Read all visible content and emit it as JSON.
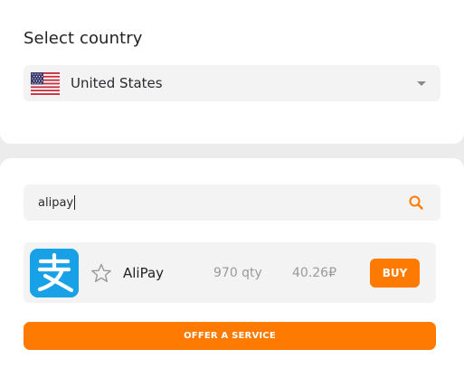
{
  "country_section": {
    "title": "Select country",
    "selected_country": "United States",
    "flag_icon": "us-flag-icon"
  },
  "search": {
    "value": "alipay",
    "icon": "search-icon"
  },
  "results": [
    {
      "name": "AliPay",
      "quantity": "970 qty",
      "price": "40.26₽",
      "buy_label": "BUY",
      "logo_color": "#19a1e8"
    }
  ],
  "offer_button_label": "OFFER A SERVICE",
  "colors": {
    "accent": "#ff7a00",
    "page_background": "#ececec",
    "card_background": "#ffffff",
    "field_background": "#f3f3f3"
  }
}
